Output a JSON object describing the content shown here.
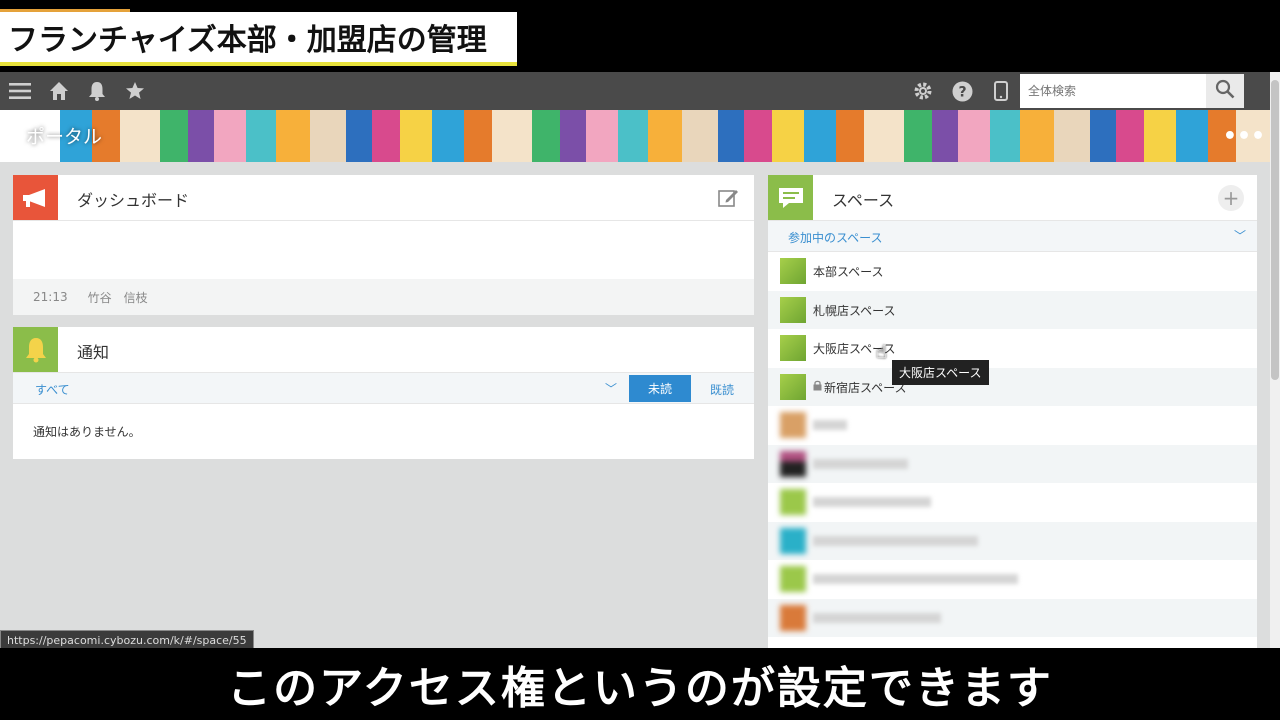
{
  "video": {
    "title": "フランチャイズ本部・加盟店の管理",
    "caption": "このアクセス権というのが設定できます"
  },
  "navbar": {
    "icons": [
      "menu-icon",
      "home-icon",
      "bell-icon",
      "star-icon",
      "gear-icon",
      "help-icon",
      "mobile-icon"
    ],
    "search_placeholder": "全体検索"
  },
  "hero": {
    "title": "ポータル"
  },
  "dashboard": {
    "title": "ダッシュボード",
    "time": "21:13",
    "author": "竹谷　信枝"
  },
  "notifications": {
    "title": "通知",
    "filter": "すべて",
    "unread_label": "未読",
    "read_label": "既読",
    "empty_text": "通知はありません。"
  },
  "spaces": {
    "title": "スペース",
    "filter": "参加中のスペース",
    "items": [
      {
        "name": "本部スペース",
        "locked": false
      },
      {
        "name": "札幌店スペース",
        "locked": false
      },
      {
        "name": "大阪店スペース",
        "locked": false
      },
      {
        "name": "新宿店スペース",
        "locked": true
      },
      {
        "name": "",
        "locked": false
      },
      {
        "name": "",
        "locked": false
      },
      {
        "name": "",
        "locked": false
      },
      {
        "name": "",
        "locked": false
      },
      {
        "name": "",
        "locked": false
      },
      {
        "name": "",
        "locked": false
      }
    ]
  },
  "tooltip": "大阪店スペース",
  "status_url": "https://pepacomi.cybozu.com/k/#/space/55",
  "colors": {
    "accent_blue": "#2e8ad0",
    "dashboard_icon": "#e8553a",
    "notif_icon": "#8bbd4a",
    "space_icon": "#8bbd4a",
    "navbar": "#4a4a4a"
  }
}
